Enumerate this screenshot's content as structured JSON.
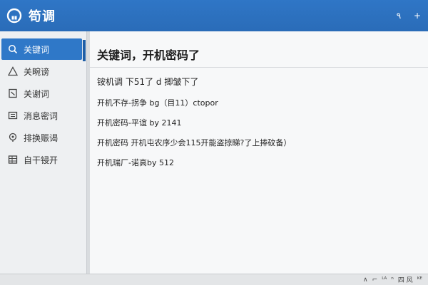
{
  "app": {
    "title": "笱调",
    "accent": "#2f76c6"
  },
  "header": {
    "actions": [
      {
        "icon": "search-icon",
        "label": "٩"
      },
      {
        "icon": "plus-icon",
        "label": "+"
      }
    ]
  },
  "sidebar": {
    "items": [
      {
        "label": "关键词",
        "icon": "search-icon",
        "active": true
      },
      {
        "label": "关畹谤",
        "icon": "warning-icon",
        "active": false
      },
      {
        "label": "关谢词",
        "icon": "document-icon",
        "active": false
      },
      {
        "label": "消息密词",
        "icon": "message-icon",
        "active": false
      },
      {
        "label": "排换赈谒",
        "icon": "location-icon",
        "active": false
      },
      {
        "label": "自干锓开",
        "icon": "table-icon",
        "active": false
      }
    ]
  },
  "main": {
    "title": "关键词，开机密码了",
    "lines": [
      "铵机调  下51了 d 揤皱下了",
      "开机不存-拐争 bg（目11）ctopor",
      "开机密码-平谊 by 2141",
      "开机密码   开机屯农序少会115开能盗掠睇?了上捧砇备）",
      "开机瑞厂-诺高by 512"
    ]
  },
  "taskbar": {
    "items": [
      "∧",
      "⌐",
      "ᴸᴬ",
      "ⁿ",
      "四 风",
      "ᴷᴱ"
    ]
  }
}
